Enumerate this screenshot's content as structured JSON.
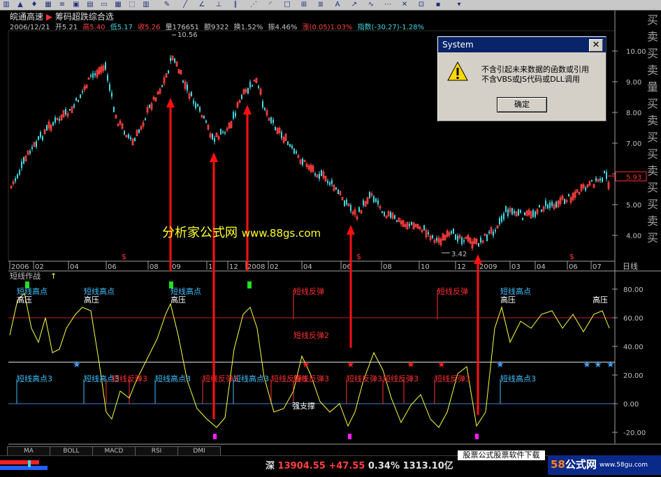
{
  "stock": {
    "name": "皖通高速",
    "indicator": "筹码超跌综合选"
  },
  "quote": {
    "date": "2006/12/21",
    "open": "开5.21",
    "high": "高5.40",
    "low": "低5.17",
    "close": "收5.26",
    "volume": "量176651",
    "amount": "额9322",
    "turnover": "换1.52%",
    "amplitude": "振4.46%",
    "change": "涨(0.05)1.03%",
    "index": "指数(-30.27)-1.28%"
  },
  "price_axis": [
    "10.00",
    "9.00",
    "8.00",
    "7.00",
    "6.00",
    "5.00",
    "4.00"
  ],
  "current_price": "5.93",
  "peak_label": "10.56",
  "trough_label": "3.42",
  "date_axis": [
    "2006",
    "02",
    "04",
    "06",
    "08",
    "09",
    "1",
    "12",
    "2008",
    "02",
    "04",
    "06",
    "08",
    "10",
    "12",
    "2009",
    "03",
    "04",
    "06",
    "07"
  ],
  "period_label": "日线",
  "sub_title": "短线作战",
  "sub_axis": [
    "80.00",
    "60.00",
    "40.00",
    "20.00",
    "0.00",
    "-20.00"
  ],
  "sub_labels": {
    "high_point": "短线高点",
    "high_press": "高压",
    "rebound": "短线反弹",
    "rebound2": "短线反弹2",
    "high_point3": "短线高点3",
    "rebound3": "短线反弹3",
    "strong_support": "强支撑"
  },
  "watermark": {
    "cn": "分析家公式网",
    "url": "www.88gs.com"
  },
  "dialog": {
    "title": "System",
    "line1": "不含引起未来数据的函数或引用",
    "line2": "不含VBS或JS代码或DLL调用",
    "ok": "确定"
  },
  "tabs": [
    "MA",
    "BOLL",
    "MACD",
    "RSI",
    "DMI"
  ],
  "market": {
    "name": "深",
    "value": "13904.55",
    "change": "+47.55",
    "pct": "0.34%",
    "amount": "1313.10亿"
  },
  "ad": "股票公式股票软件下载",
  "logo": {
    "num": "58",
    "word": "公式网",
    "url": "www.58gu.com"
  },
  "right_chars": [
    "买",
    "卖",
    "买",
    "卖",
    "量",
    "买",
    "卖",
    "买",
    "买",
    "卖",
    "买",
    "买",
    "卖",
    "买"
  ],
  "colors": {
    "up": "#ff4040",
    "down": "#40d8e0",
    "line": "#ffff40",
    "arrow": "#ff1010"
  }
}
